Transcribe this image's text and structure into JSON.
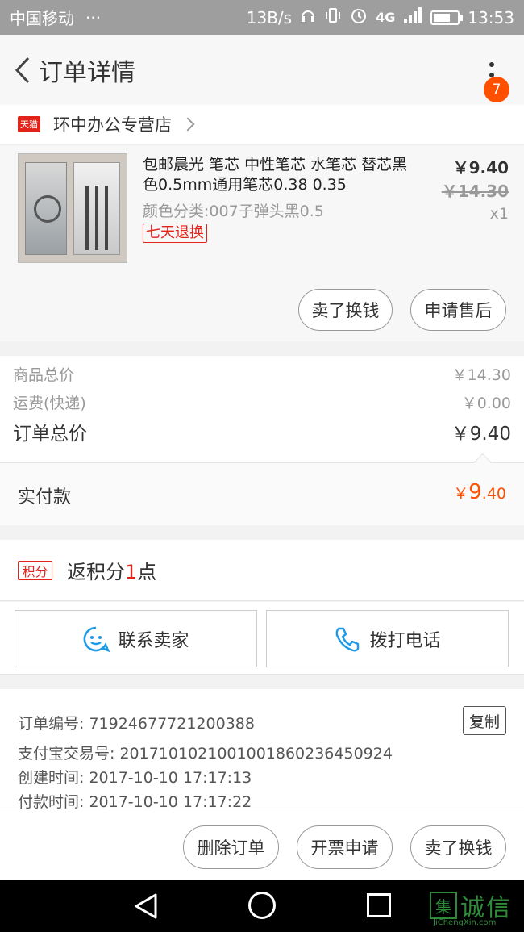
{
  "status_bar": {
    "carrier": "中国移动",
    "dots": "···",
    "speed": "13B/s",
    "network": "4G",
    "time": "13:53"
  },
  "header": {
    "title": "订单详情",
    "badge_count": "7"
  },
  "shop": {
    "tag": "天猫",
    "name": "环中办公专营店"
  },
  "item": {
    "title": "包邮晨光 笔芯 中性笔芯 水笔芯 替芯黑色0.5mm通用笔芯0.38 0.35",
    "sku": "颜色分类:007子弹头黑0.5",
    "return_tag": "七天退换",
    "price_now": "￥9.40",
    "price_original": "￥14.30",
    "quantity": "x1",
    "buttons": {
      "sell": "卖了换钱",
      "after_sale": "申请售后"
    }
  },
  "totals": {
    "goods_label": "商品总价",
    "goods_value": "￥14.30",
    "shipping_label": "运费(快递)",
    "shipping_value": "￥0.00",
    "order_label": "订单总价",
    "order_value": "￥9.40",
    "paid_label": "实付款",
    "paid_currency": "￥",
    "paid_integer": "9",
    "paid_decimal": ".40"
  },
  "points": {
    "tag": "积分",
    "prefix": "返积分",
    "count": "1",
    "suffix": "点"
  },
  "contact": {
    "seller": "联系卖家",
    "phone": "拨打电话"
  },
  "order_info": {
    "order_no_label": "订单编号:",
    "order_no": "71924677721200388",
    "alipay_label": "支付宝交易号:",
    "alipay_no": "2017101021001001860236450924",
    "created_label": "创建时间:",
    "created": "2017-10-10 17:17:13",
    "paid_label": "付款时间:",
    "paid": "2017-10-10 17:17:22",
    "copy_button": "复制"
  },
  "actions": {
    "delete": "删除订单",
    "invoice": "开票申请",
    "sell": "卖了换钱"
  },
  "watermark": {
    "logo": "集",
    "text": "诚信",
    "sub": "JiChengXin.com"
  },
  "colors": {
    "accent": "#ff5000",
    "tmall_red": "#e2231a",
    "contact_blue": "#1e9be8",
    "watermark_green": "#2e8b3a"
  }
}
